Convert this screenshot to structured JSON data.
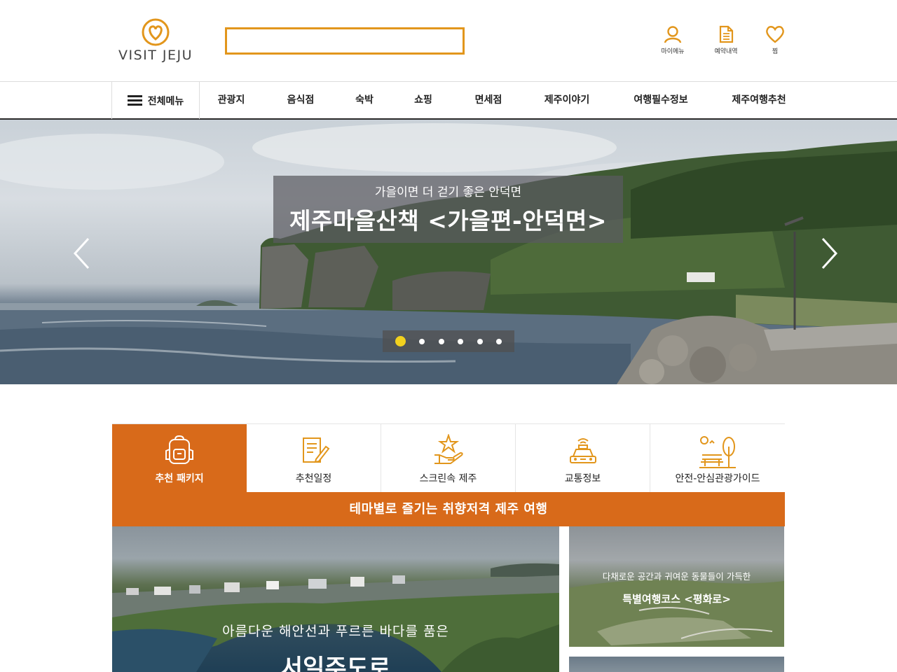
{
  "brand": {
    "logo_text": "VISIT JEJU",
    "accent": "#e2961c",
    "orange": "#d86a1a"
  },
  "search": {
    "value": "",
    "placeholder": ""
  },
  "utility": [
    {
      "label": "마이메뉴",
      "icon": "user-icon"
    },
    {
      "label": "예약내역",
      "icon": "document-icon"
    },
    {
      "label": "찜",
      "icon": "heart-icon"
    }
  ],
  "nav": {
    "all_menu": "전체메뉴",
    "items": [
      "관광지",
      "음식점",
      "숙박",
      "쇼핑",
      "면세점",
      "제주이야기",
      "여행필수정보",
      "제주여행추천"
    ]
  },
  "hero": {
    "subtitle": "가을이면 더 걷기 좋은 안덕면",
    "title": "제주마을산책 <가을편-안덕면>",
    "slide_count": 6,
    "active_slide": 1
  },
  "tabs": [
    {
      "label": "추천 패키지",
      "icon": "backpack-icon",
      "active": true
    },
    {
      "label": "추천일정",
      "icon": "schedule-icon",
      "active": false
    },
    {
      "label": "스크린속 제주",
      "icon": "star-hand-icon",
      "active": false
    },
    {
      "label": "교통정보",
      "icon": "taxi-icon",
      "active": false
    },
    {
      "label": "안전-안심관광가이드",
      "icon": "park-bench-icon",
      "active": false
    }
  ],
  "theme_banner": "테마별로 즐기는 취향저격 제주 여행",
  "cards": {
    "big": {
      "subtitle": "아름다운 해안선과 푸르른 바다를 품은",
      "title": "서일주도로"
    },
    "small": {
      "subtitle": "다채로운 공간과 귀여운 동물들이 가득한",
      "title": "특별여행코스 <평화로>"
    }
  }
}
